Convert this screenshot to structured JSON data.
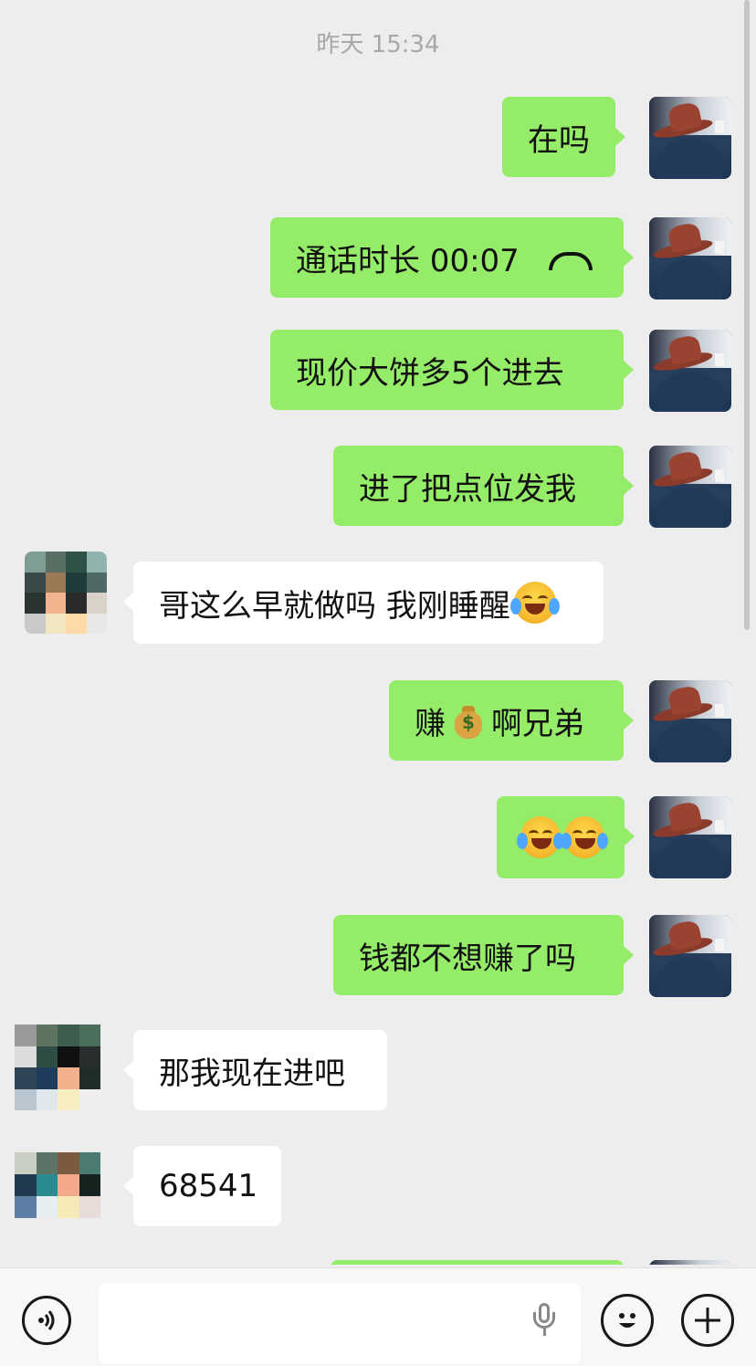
{
  "timestamp": "昨天 15:34",
  "messages": [
    {
      "side": "me",
      "text": "在吗"
    },
    {
      "side": "me",
      "type": "call",
      "text": "通话时长 00:07",
      "icon": "phone-hangup-icon"
    },
    {
      "side": "me",
      "text": "现价大饼多5个进去"
    },
    {
      "side": "me",
      "text": "进了把点位发我"
    },
    {
      "side": "other",
      "text": "哥这么早就做吗 我刚睡醒",
      "icon": "crying-laughing-emoji"
    },
    {
      "side": "me",
      "text_before": "赚",
      "icon": "money-bag-emoji",
      "text_after": "啊兄弟"
    },
    {
      "side": "me",
      "icons": [
        "crying-laughing-emoji",
        "crying-laughing-emoji"
      ]
    },
    {
      "side": "me",
      "text": "钱都不想赚了吗"
    },
    {
      "side": "other",
      "text": "那我现在进吧"
    },
    {
      "side": "other",
      "text": "68541"
    }
  ],
  "input_bar": {
    "voice_icon": "voice-icon",
    "mic_icon": "microphone-icon",
    "emoji_icon": "emoji-icon",
    "plus_icon": "plus-icon"
  },
  "colors": {
    "background": "#ededed",
    "my_bubble": "#95ec69",
    "other_bubble": "#ffffff"
  }
}
